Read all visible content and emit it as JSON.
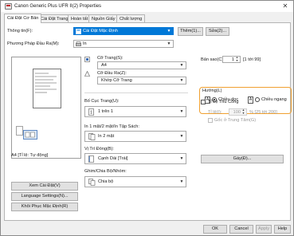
{
  "window": {
    "title": "Canon Generic Plus UFR II(2) Properties"
  },
  "tabs": [
    "Cài Đặt Cơ Bản",
    "Cài Đặt Trang",
    "Hoàn tất",
    "Nguồn Giấy",
    "Chất lượng"
  ],
  "header": {
    "profile_label": "Thông tin(F):",
    "profile_value": "Cài Đặt Mặc Định",
    "add_button": "Thêm(1)...",
    "edit_button": "Sửa(2)...",
    "output_label": "Phương Pháp Đầu Ra(M):",
    "output_value": "In"
  },
  "preview": {
    "caption": "A4 [Tỉ lệ: Tự động]"
  },
  "left_buttons": [
    "Xem Cài Đặt(V)",
    "Language Settings(N)...",
    "Khôi Phục Mặc Định(R)"
  ],
  "page_size": {
    "label": "Cỡ Trang(S):",
    "value": "A4"
  },
  "output_size": {
    "label": "Cỡ Đầu Ra(Z):",
    "value": "Khớp Cỡ Trang"
  },
  "copies": {
    "label": "Bản sao(C):",
    "value": "1",
    "range": "[1 tới 99]"
  },
  "orientation": {
    "label": "Hướng(L)",
    "portrait": "Chiều dọc",
    "landscape": "Chiều ngang",
    "selected": "portrait"
  },
  "layout": {
    "label": "Bố Cục Trang(U):",
    "value": "1 trên 1"
  },
  "manual_scaling": {
    "label": "Tỉ Lệ Thủ Công",
    "scale_label": "Tỉ lệ(I):",
    "scale_value": "100",
    "scale_range": "% [25 tới 200]"
  },
  "rotate": {
    "label": "Gốc ở Trung Tâm(G)"
  },
  "duplex": {
    "label": "In 1 mặt/2 mặt/In Tập Sách:",
    "value": "In 2 mặt"
  },
  "binding": {
    "label": "Vị Trí Đóng(B):",
    "value": "Cạnh Dài [Trái]",
    "button": "Gáy(Đ)..."
  },
  "finishing": {
    "label": "Ghim/Chia Bộ/Nhóm:",
    "value": "Chia bộ"
  },
  "footer": {
    "ok": "OK",
    "cancel": "Cancel",
    "apply": "Apply",
    "help": "Help"
  },
  "colors": {
    "highlight": "#0078d7",
    "orientation_border": "#f0a030"
  }
}
